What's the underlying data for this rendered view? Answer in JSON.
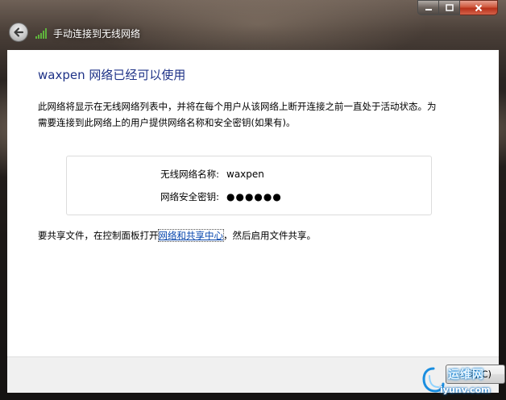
{
  "window": {
    "title": "手动连接到无线网络",
    "caption_buttons": {
      "minimize": "−",
      "maximize": "□",
      "close": "✕"
    },
    "back_icon": "back-arrow-icon",
    "network_icon": "wireless-signal-icon"
  },
  "main": {
    "heading": "waxpen 网络已经可以使用",
    "description": "此网络将显示在无线网络列表中，并将在每个用户从该网络上断开连接之前一直处于活动状态。为需要连接到此网络上的用户提供网络名称和安全密钥(如果有)。",
    "network_name_label": "无线网络名称:",
    "network_name_value": "waxpen",
    "security_key_label": "网络安全密钥:",
    "security_key_value": "●●●●●●",
    "share_prefix": "要共享文件，在控制面板打开",
    "share_link": "网络和共享中心",
    "share_suffix": "，然后启用文件共享。"
  },
  "footer": {
    "close_label": "关闭(C)"
  },
  "watermark": {
    "top": "运维网",
    "bottom": "iyunv.com"
  },
  "colors": {
    "heading": "#1e3287",
    "link": "#0645ad",
    "footer_bg": "#f0f0f0",
    "close_red": "#c8452c"
  }
}
